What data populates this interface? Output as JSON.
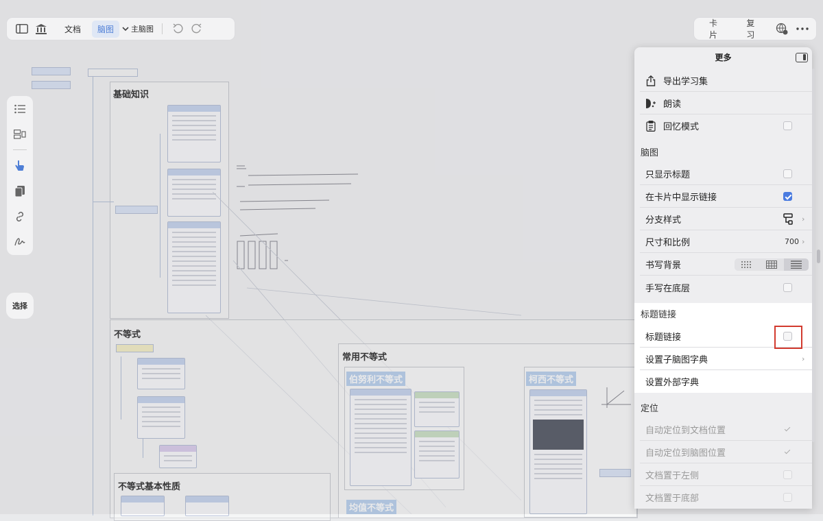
{
  "toolbar": {
    "doc_tab": "文档",
    "mindmap_tab": "脑图",
    "main_mindmap": "主脑图"
  },
  "toolbar_right": {
    "cards": "卡片",
    "review": "复习"
  },
  "left_rail": {
    "select": "选择"
  },
  "canvas": {
    "sections": [
      "基础知识",
      "不等式",
      "常用不等式",
      "不等式基本性质"
    ],
    "labels": [
      "伯努利不等式",
      "柯西不等式",
      "均值不等式"
    ]
  },
  "panel": {
    "title": "更多",
    "items": [
      {
        "label": "导出学习集",
        "icon": "share-icon"
      },
      {
        "label": "朗读",
        "icon": "speaker-icon"
      },
      {
        "label": "回忆模式",
        "icon": "clipboard-icon",
        "checked": false
      }
    ],
    "mindmap_section": "脑图",
    "mindmap_items": [
      {
        "label": "只显示标题",
        "checked": false
      },
      {
        "label": "在卡片中显示链接",
        "checked": true
      },
      {
        "label": "分支样式",
        "icon": "branch-style-icon"
      },
      {
        "label": "尺寸和比例",
        "value": "700"
      },
      {
        "label": "书写背景",
        "icon": "background-segment"
      },
      {
        "label": "手写在底层",
        "checked": false
      }
    ],
    "title_link_section": "标题链接",
    "title_link_items": [
      {
        "label": "标题链接",
        "checked": false
      },
      {
        "label": "设置子脑图字典"
      },
      {
        "label": "设置外部字典"
      }
    ],
    "position_section": "定位",
    "position_items": [
      {
        "label": "自动定位到文档位置",
        "checked": true
      },
      {
        "label": "自动定位到脑图位置",
        "checked": true
      },
      {
        "label": "文档置于左侧",
        "checked": false
      },
      {
        "label": "文档置于底部",
        "checked": false
      }
    ]
  }
}
